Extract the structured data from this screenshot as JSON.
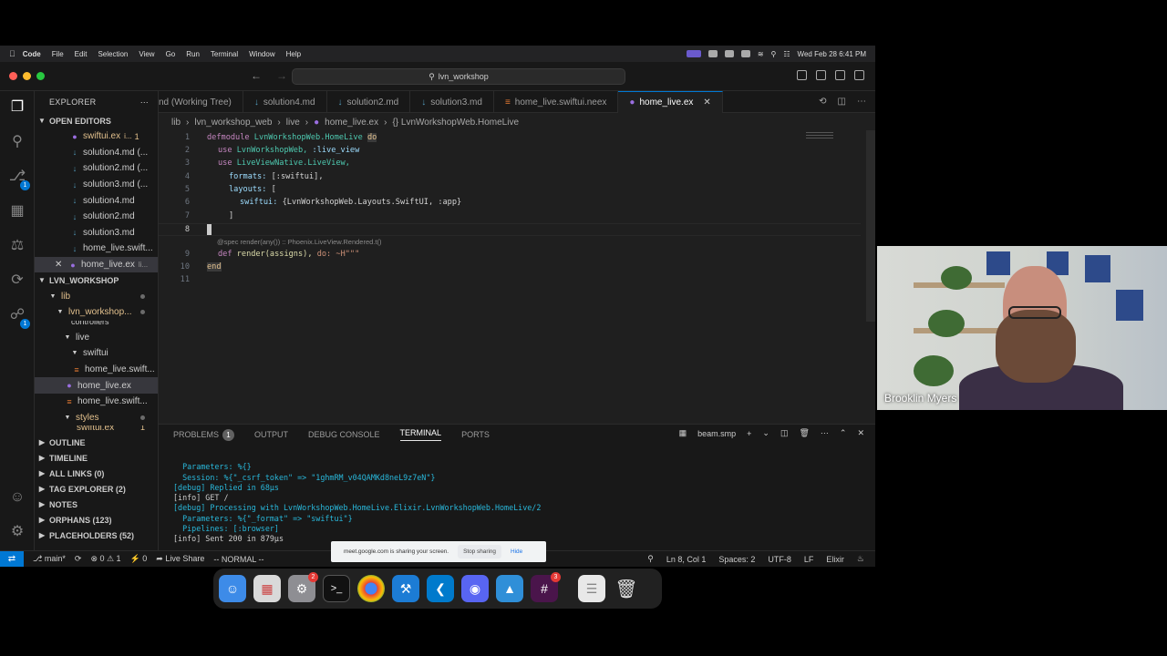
{
  "menubar": {
    "app": "Code",
    "items": [
      "File",
      "Edit",
      "Selection",
      "View",
      "Go",
      "Run",
      "Terminal",
      "Window",
      "Help"
    ],
    "datetime": "Wed Feb 28  6:41 PM"
  },
  "titlebar": {
    "search": "lvn_workshop"
  },
  "activity": {
    "source_control_badge": "1",
    "remote_badge": "1"
  },
  "sidebar": {
    "title": "EXPLORER",
    "open_editors_label": "OPEN EDITORS",
    "open_editors": [
      {
        "name": "swiftui.ex",
        "suffix": "i...",
        "mod": "1"
      },
      {
        "name": "solution4.md (...",
        "suffix": "",
        "mod": ""
      },
      {
        "name": "solution2.md (...",
        "suffix": "",
        "mod": ""
      },
      {
        "name": "solution3.md (...",
        "suffix": "",
        "mod": ""
      },
      {
        "name": "solution4.md",
        "suffix": "",
        "mod": ""
      },
      {
        "name": "solution2.md",
        "suffix": "",
        "mod": ""
      },
      {
        "name": "solution3.md",
        "suffix": "",
        "mod": ""
      },
      {
        "name": "home_live.swift...",
        "suffix": "",
        "mod": ""
      },
      {
        "name": "home_live.ex",
        "suffix": "li...",
        "mod": ""
      }
    ],
    "workspace_label": "LVN_WORKSHOP",
    "tree": [
      {
        "name": "lib"
      },
      {
        "name": "lvn_workshop..."
      },
      {
        "name": "controllers"
      },
      {
        "name": "live"
      },
      {
        "name": "swiftui"
      },
      {
        "name": "home_live.swift..."
      },
      {
        "name": "home_live.ex"
      },
      {
        "name": "home_live.swift..."
      },
      {
        "name": "styles"
      },
      {
        "name": "swiftui.ex",
        "mod": "1"
      }
    ],
    "sections": [
      "OUTLINE",
      "TIMELINE",
      "ALL LINKS (0)",
      "TAG EXPLORER (2)",
      "NOTES",
      "ORPHANS (123)",
      "PLACEHOLDERS (52)"
    ]
  },
  "tabs": [
    {
      "label": "nd (Working Tree)"
    },
    {
      "label": "solution4.md"
    },
    {
      "label": "solution2.md"
    },
    {
      "label": "solution3.md"
    },
    {
      "label": "home_live.swiftui.neex"
    },
    {
      "label": "home_live.ex"
    }
  ],
  "breadcrumb": [
    "lib",
    "lvn_workshop_web",
    "live",
    "home_live.ex",
    "{} LvnWorkshopWeb.HomeLive"
  ],
  "editor": {
    "line_numbers": [
      "1",
      "2",
      "3",
      "4",
      "5",
      "6",
      "7",
      "8",
      "9",
      "10",
      "11"
    ],
    "l1": {
      "kw": "defmodule",
      "mod": "LvnWorkshopWeb.HomeLive",
      "do": "do"
    },
    "l2": {
      "kw": "use",
      "mod": "LvnWorkshopWeb,",
      "atom": ":live_view"
    },
    "l3": {
      "kw": "use",
      "mod": "LiveViewNative.LiveView,"
    },
    "l4": {
      "key": "formats:",
      "rest": "[:swiftui],"
    },
    "l5": {
      "key": "layouts:",
      "rest": "["
    },
    "l6": {
      "key": "swiftui:",
      "rest": "{LvnWorkshopWeb.Layouts.SwiftUI, :app}"
    },
    "l7": "]",
    "codelens": "@spec render(any()) :: Phoenix.LiveView.Rendered.t()",
    "l9": {
      "kw": "def",
      "fn": "render(assigns),",
      "rest": "do: ~H\"\"\""
    },
    "l10": "end"
  },
  "panel": {
    "tabs": [
      "PROBLEMS",
      "OUTPUT",
      "DEBUG CONSOLE",
      "TERMINAL",
      "PORTS"
    ],
    "problems_count": "1",
    "terminal_name": "beam.smp",
    "terminal_lines": [
      "  Parameters: %{}",
      "  Session: %{\"_csrf_token\" => \"1ghmRM_v04QAMKd8neL9z7eN\"}",
      "[debug] Replied in 68µs",
      "[info] GET /",
      "[debug] Processing with LvnWorkshopWeb.HomeLive.Elixir.LvnWorkshopWeb.HomeLive/2",
      "  Parameters: %{\"_format\" => \"swiftui\"}",
      "  Pipelines: [:browser]",
      "[info] Sent 200 in 879µs"
    ]
  },
  "statusbar": {
    "branch": "main*",
    "errors": "⊗ 0 ⚠ 1",
    "ports": "⚡ 0",
    "live_share": "Live Share",
    "mode": "-- NORMAL --",
    "position": "Ln 8, Col 1",
    "spaces": "Spaces: 2",
    "encoding": "UTF-8",
    "eol": "LF",
    "language": "Elixir"
  },
  "share_banner": {
    "text": "meet.google.com is sharing your screen.",
    "stop": "Stop sharing",
    "hide": "Hide"
  },
  "dock": {
    "apps": [
      "finder-icon",
      "launchpad-icon",
      "settings-icon",
      "terminal-icon",
      "chrome-icon",
      "xcode-icon",
      "vscode-icon",
      "discord-icon",
      "simulator-icon",
      "slack-icon",
      "notes-icon",
      "trash-icon"
    ],
    "settings_badge": "2",
    "slack_badge": "3"
  },
  "video": {
    "participant": "Brooklin Myers"
  },
  "colors": {
    "accent": "#0078d4",
    "statusbar": "#181818",
    "editor_bg": "#1f1f1f"
  }
}
